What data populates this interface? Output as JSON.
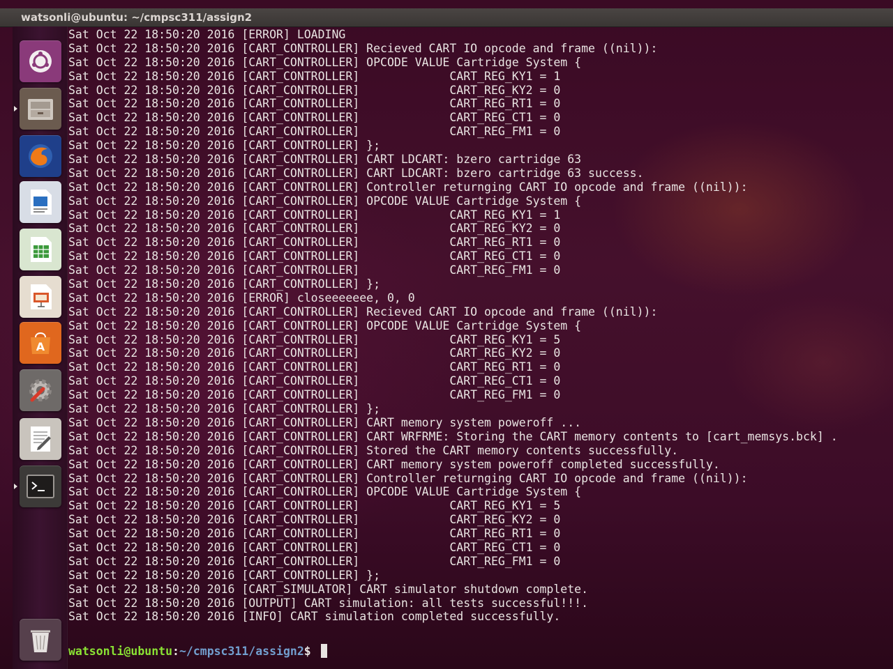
{
  "window": {
    "title": "watsonli@ubuntu: ~/cmpsc311/assign2"
  },
  "launcher": {
    "items": [
      {
        "name": "ubuntu-dash-icon",
        "bg": "#8a3a7a",
        "active": false
      },
      {
        "name": "files-icon",
        "bg": "#6b5b4f",
        "active": true
      },
      {
        "name": "firefox-icon",
        "bg": "#1f3f8a",
        "active": false
      },
      {
        "name": "libreoffice-writer-icon",
        "bg": "#d8dde6",
        "active": false
      },
      {
        "name": "libreoffice-calc-icon",
        "bg": "#d9e6d0",
        "active": false
      },
      {
        "name": "libreoffice-impress-icon",
        "bg": "#e6ddd0",
        "active": false
      },
      {
        "name": "ubuntu-software-icon",
        "bg": "#e0671e",
        "active": false
      },
      {
        "name": "system-settings-icon",
        "bg": "#6e6a68",
        "active": false
      },
      {
        "name": "text-editor-icon",
        "bg": "#c9c4bd",
        "active": false
      },
      {
        "name": "terminal-icon",
        "bg": "#3c3a38",
        "active": true
      },
      {
        "name": "trash-icon",
        "bg": "#56404c",
        "active": false
      }
    ]
  },
  "terminal": {
    "lines": [
      "Sat Oct 22 18:50:20 2016 [ERROR] LOADING",
      "Sat Oct 22 18:50:20 2016 [CART_CONTROLLER] Recieved CART IO opcode and frame ((nil)):",
      "Sat Oct 22 18:50:20 2016 [CART_CONTROLLER] OPCODE VALUE Cartridge System {",
      "Sat Oct 22 18:50:20 2016 [CART_CONTROLLER]             CART_REG_KY1 = 1",
      "Sat Oct 22 18:50:20 2016 [CART_CONTROLLER]             CART_REG_KY2 = 0",
      "Sat Oct 22 18:50:20 2016 [CART_CONTROLLER]             CART_REG_RT1 = 0",
      "Sat Oct 22 18:50:20 2016 [CART_CONTROLLER]             CART_REG_CT1 = 0",
      "Sat Oct 22 18:50:20 2016 [CART_CONTROLLER]             CART_REG_FM1 = 0",
      "Sat Oct 22 18:50:20 2016 [CART_CONTROLLER] };",
      "Sat Oct 22 18:50:20 2016 [CART_CONTROLLER] CART LDCART: bzero cartridge 63",
      "Sat Oct 22 18:50:20 2016 [CART_CONTROLLER] CART LDCART: bzero cartridge 63 success.",
      "Sat Oct 22 18:50:20 2016 [CART_CONTROLLER] Controller returnging CART IO opcode and frame ((nil)):",
      "Sat Oct 22 18:50:20 2016 [CART_CONTROLLER] OPCODE VALUE Cartridge System {",
      "Sat Oct 22 18:50:20 2016 [CART_CONTROLLER]             CART_REG_KY1 = 1",
      "Sat Oct 22 18:50:20 2016 [CART_CONTROLLER]             CART_REG_KY2 = 0",
      "Sat Oct 22 18:50:20 2016 [CART_CONTROLLER]             CART_REG_RT1 = 0",
      "Sat Oct 22 18:50:20 2016 [CART_CONTROLLER]             CART_REG_CT1 = 0",
      "Sat Oct 22 18:50:20 2016 [CART_CONTROLLER]             CART_REG_FM1 = 0",
      "Sat Oct 22 18:50:20 2016 [CART_CONTROLLER] };",
      "Sat Oct 22 18:50:20 2016 [ERROR] closeeeeeee, 0, 0",
      "Sat Oct 22 18:50:20 2016 [CART_CONTROLLER] Recieved CART IO opcode and frame ((nil)):",
      "Sat Oct 22 18:50:20 2016 [CART_CONTROLLER] OPCODE VALUE Cartridge System {",
      "Sat Oct 22 18:50:20 2016 [CART_CONTROLLER]             CART_REG_KY1 = 5",
      "Sat Oct 22 18:50:20 2016 [CART_CONTROLLER]             CART_REG_KY2 = 0",
      "Sat Oct 22 18:50:20 2016 [CART_CONTROLLER]             CART_REG_RT1 = 0",
      "Sat Oct 22 18:50:20 2016 [CART_CONTROLLER]             CART_REG_CT1 = 0",
      "Sat Oct 22 18:50:20 2016 [CART_CONTROLLER]             CART_REG_FM1 = 0",
      "Sat Oct 22 18:50:20 2016 [CART_CONTROLLER] };",
      "Sat Oct 22 18:50:20 2016 [CART_CONTROLLER] CART memory system poweroff ...",
      "Sat Oct 22 18:50:20 2016 [CART_CONTROLLER] CART WRFRME: Storing the CART memory contents to [cart_memsys.bck] .",
      "Sat Oct 22 18:50:20 2016 [CART_CONTROLLER] Stored the CART memory contents successfully.",
      "Sat Oct 22 18:50:20 2016 [CART_CONTROLLER] CART memory system poweroff completed successfully.",
      "Sat Oct 22 18:50:20 2016 [CART_CONTROLLER] Controller returnging CART IO opcode and frame ((nil)):",
      "Sat Oct 22 18:50:20 2016 [CART_CONTROLLER] OPCODE VALUE Cartridge System {",
      "Sat Oct 22 18:50:20 2016 [CART_CONTROLLER]             CART_REG_KY1 = 5",
      "Sat Oct 22 18:50:20 2016 [CART_CONTROLLER]             CART_REG_KY2 = 0",
      "Sat Oct 22 18:50:20 2016 [CART_CONTROLLER]             CART_REG_RT1 = 0",
      "Sat Oct 22 18:50:20 2016 [CART_CONTROLLER]             CART_REG_CT1 = 0",
      "Sat Oct 22 18:50:20 2016 [CART_CONTROLLER]             CART_REG_FM1 = 0",
      "Sat Oct 22 18:50:20 2016 [CART_CONTROLLER] };",
      "Sat Oct 22 18:50:20 2016 [CART_SIMULATOR] CART simulator shutdown complete.",
      "Sat Oct 22 18:50:20 2016 [OUTPUT] CART simulation: all tests successful!!!.",
      "Sat Oct 22 18:50:20 2016 [INFO] CART simulation completed successfully."
    ],
    "prompt": {
      "user_host": "watsonli@ubuntu",
      "separator": ":",
      "path": "~/cmpsc311/assign2",
      "symbol": "$"
    }
  },
  "colors": {
    "prompt_user": "#8ae234",
    "prompt_path": "#729fcf",
    "text": "#e9e4e2"
  }
}
